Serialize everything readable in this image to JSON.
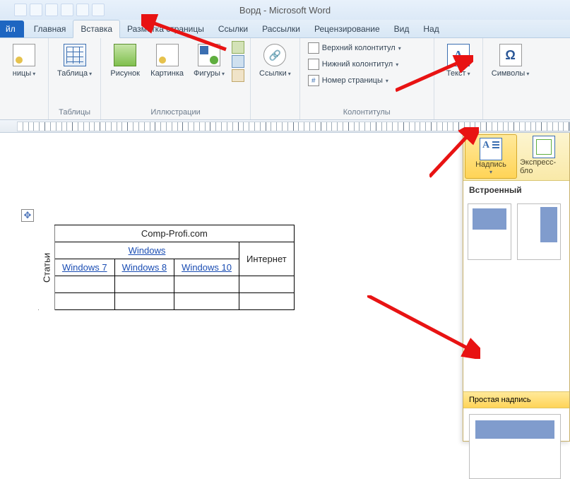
{
  "title": "Ворд - Microsoft Word",
  "tabs": {
    "file": "йл",
    "home": "Главная",
    "insert": "Вставка",
    "layout": "Разметка страницы",
    "refs": "Ссылки",
    "mail": "Рассылки",
    "review": "Рецензирование",
    "view": "Вид",
    "add": "Над"
  },
  "ribbon": {
    "pages": {
      "label": "ницы"
    },
    "tables": {
      "btn": "Таблица",
      "label": "Таблицы"
    },
    "illustrations": {
      "pic": "Рисунок",
      "clip": "Картинка",
      "shapes": "Фигуры",
      "label": "Иллюстрации"
    },
    "links": {
      "btn": "Ссылки"
    },
    "headers": {
      "top": "Верхний колонтитул",
      "bottom": "Нижний колонтитул",
      "page": "Номер страницы",
      "label": "Колонтитулы"
    },
    "text": {
      "btn": "Текст"
    },
    "symbols": {
      "btn": "Символы"
    }
  },
  "gallery": {
    "textbox": "Надпись",
    "express": "Экспресс-бло",
    "section1": "Встроенный",
    "section2": "Простая надпись"
  },
  "table": {
    "r1": "Comp-Profi.com",
    "r2": "Windows",
    "c1": "Windows 7",
    "c2": "Windows 8",
    "c3": "Windows 10",
    "c4": "Интернет",
    "side": "Статьи"
  }
}
